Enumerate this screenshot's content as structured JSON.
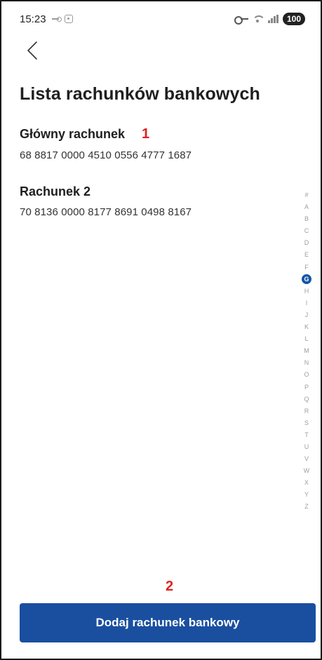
{
  "status_bar": {
    "time": "15:23",
    "battery": "100",
    "icons": [
      "key-icon",
      "screen-record-icon",
      "vpn-key-icon",
      "wifi-icon",
      "signal-icon",
      "battery-icon"
    ]
  },
  "header": {
    "back_icon": "chevron-left-icon",
    "title": "Lista rachunków bankowych"
  },
  "accounts": [
    {
      "name": "Główny rachunek",
      "number": "68 8817 0000 4510 0556 4777 1687"
    },
    {
      "name": "Rachunek 2",
      "number": "70 8136 0000 8177 8691 0498 8167"
    }
  ],
  "alphabet_index": {
    "letters": [
      "#",
      "A",
      "B",
      "C",
      "D",
      "E",
      "F",
      "G",
      "H",
      "I",
      "J",
      "K",
      "L",
      "M",
      "N",
      "O",
      "P",
      "Q",
      "R",
      "S",
      "T",
      "U",
      "V",
      "W",
      "X",
      "Y",
      "Z"
    ],
    "active": "G",
    "accent_color": "#1656a8"
  },
  "annotations": {
    "one": "1",
    "two": "2",
    "color": "#e02020"
  },
  "add_button": {
    "label": "Dodaj rachunek bankowy",
    "color": "#1a4fa0"
  }
}
